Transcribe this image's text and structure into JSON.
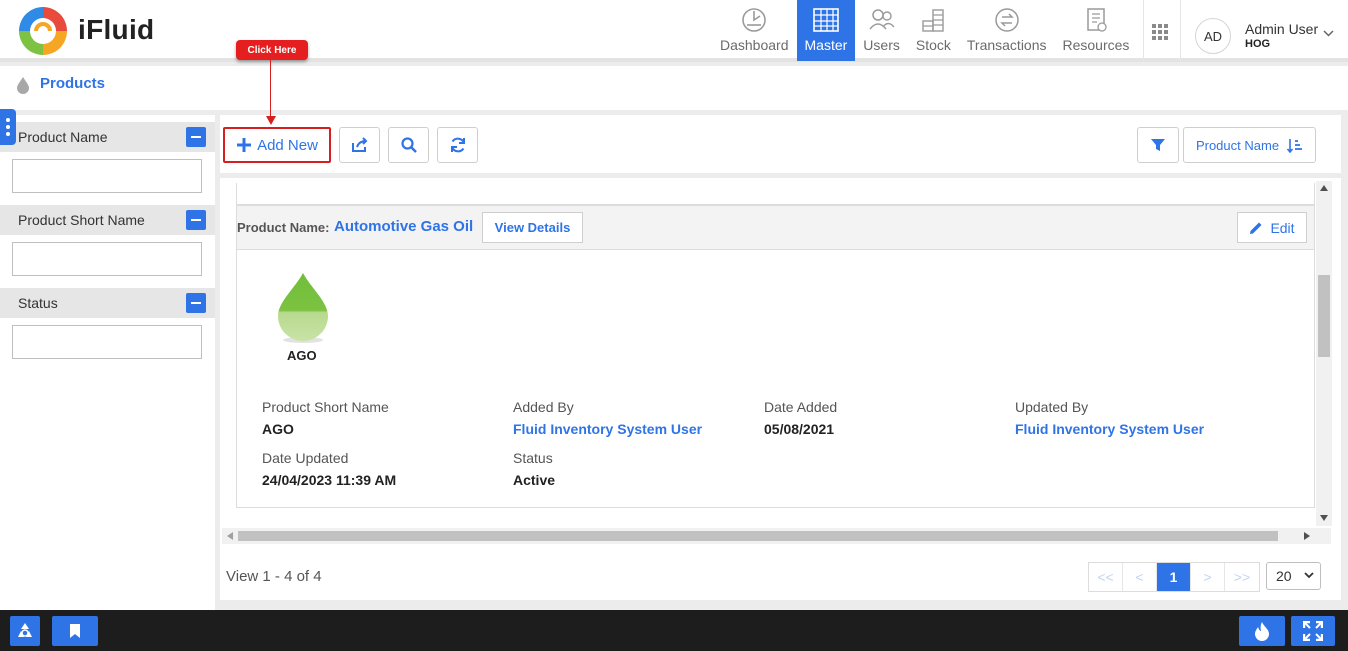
{
  "app": {
    "brand": "iFluid"
  },
  "nav": [
    {
      "label": "Dashboard",
      "icon": "speedometer-icon",
      "active": false
    },
    {
      "label": "Master",
      "icon": "master-grid-icon",
      "active": true
    },
    {
      "label": "Users",
      "icon": "users-icon",
      "active": false
    },
    {
      "label": "Stock",
      "icon": "stock-coins-icon",
      "active": false
    },
    {
      "label": "Transactions",
      "icon": "transactions-arrows-icon",
      "active": false
    },
    {
      "label": "Resources",
      "icon": "resources-document-icon",
      "active": false
    }
  ],
  "user": {
    "initials": "AD",
    "name": "Admin User",
    "org": "HOG"
  },
  "breadcrumb": {
    "title": "Products"
  },
  "callout": {
    "text": "Click Here"
  },
  "filters": [
    {
      "label": "Product Name",
      "value": ""
    },
    {
      "label": "Product Short Name",
      "value": ""
    },
    {
      "label": "Status",
      "value": ""
    }
  ],
  "toolbar": {
    "add_new": "Add New",
    "sort_label": "Product Name"
  },
  "product": {
    "name_label": "Product Name:",
    "name": "Automotive Gas Oil",
    "view_details": "View Details",
    "edit": "Edit",
    "code": "AGO",
    "drop_color": "#7dc242",
    "fields": {
      "short_name_label": "Product Short Name",
      "short_name": "AGO",
      "added_by_label": "Added By",
      "added_by": "Fluid Inventory System User",
      "date_added_label": "Date Added",
      "date_added": "05/08/2021",
      "updated_by_label": "Updated By",
      "updated_by": "Fluid Inventory System User",
      "date_updated_label": "Date Updated",
      "date_updated": "24/04/2023 11:39 AM",
      "status_label": "Status",
      "status": "Active"
    }
  },
  "pagination": {
    "summary": "View 1 - 4 of 4",
    "first": "<<",
    "prev": "<",
    "current": "1",
    "next": ">",
    "last": ">>",
    "page_size": "20"
  },
  "colors": {
    "accent": "#2f74e6",
    "callout": "#e51f1f",
    "footer": "#1d1d1d"
  }
}
